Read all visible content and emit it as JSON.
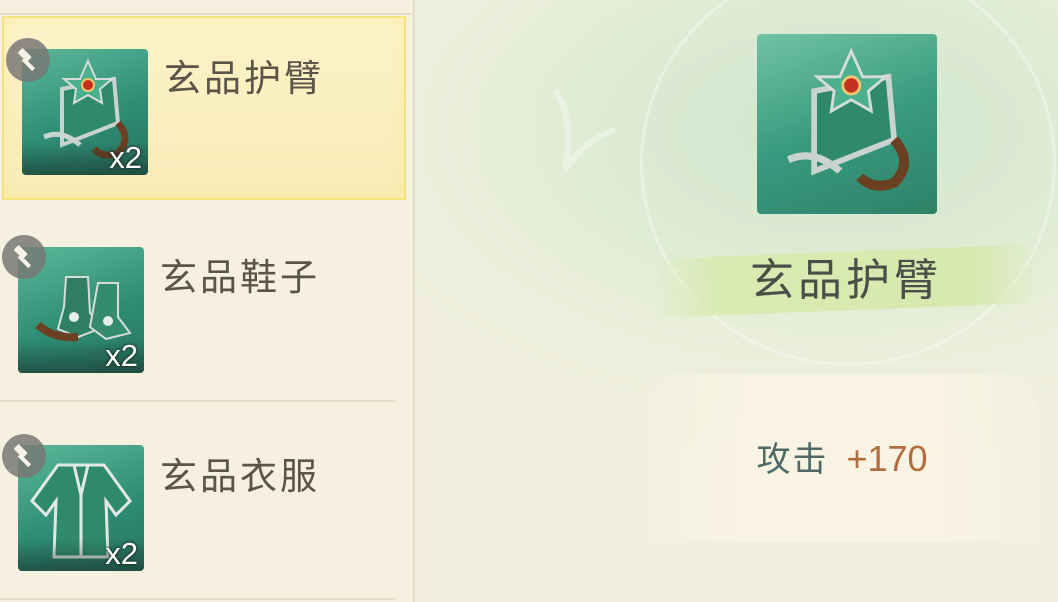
{
  "inventory": {
    "items": [
      {
        "name": "玄品护臂",
        "quantity": "x2",
        "icon": "bracer-icon",
        "selected": true
      },
      {
        "name": "玄品鞋子",
        "quantity": "x2",
        "icon": "boots-icon",
        "selected": false
      },
      {
        "name": "玄品衣服",
        "quantity": "x2",
        "icon": "robe-icon",
        "selected": false
      }
    ]
  },
  "detail": {
    "name": "玄品护臂",
    "icon": "bracer-icon",
    "stat": {
      "label": "攻击",
      "value": "+170"
    }
  },
  "colors": {
    "item_green": "#3a9b7f",
    "selected_highlight": "#f8ebb6",
    "stat_value": "#b26d3f",
    "stat_label": "#4f6a66"
  }
}
